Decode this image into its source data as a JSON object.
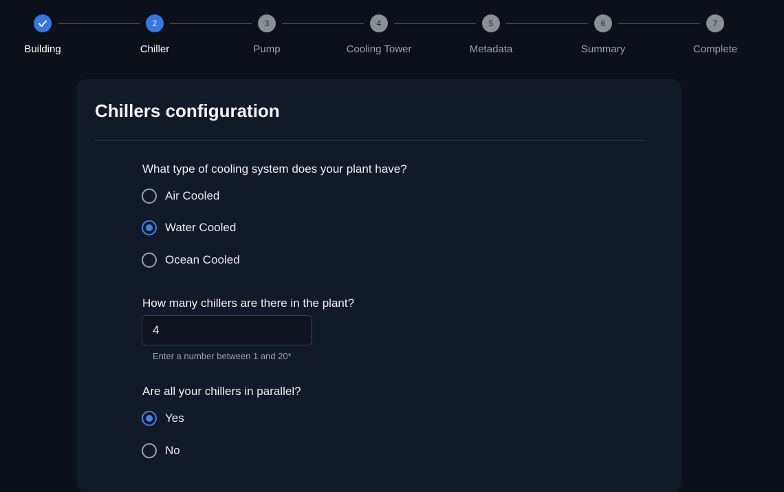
{
  "stepper": {
    "steps": [
      {
        "number": "1",
        "label": "Building",
        "status": "done"
      },
      {
        "number": "2",
        "label": "Chiller",
        "status": "active"
      },
      {
        "number": "3",
        "label": "Pump",
        "status": "pending"
      },
      {
        "number": "4",
        "label": "Cooling Tower",
        "status": "pending"
      },
      {
        "number": "5",
        "label": "Metadata",
        "status": "pending"
      },
      {
        "number": "6",
        "label": "Summary",
        "status": "pending"
      },
      {
        "number": "7",
        "label": "Complete",
        "status": "pending"
      }
    ]
  },
  "card": {
    "title": "Chillers configuration",
    "cooling": {
      "question": "What type of cooling system does your plant have?",
      "options": [
        "Air Cooled",
        "Water Cooled",
        "Ocean Cooled"
      ],
      "selected": "Water Cooled"
    },
    "count": {
      "question": "How many chillers are there in the plant?",
      "value": "4",
      "hint": "Enter a number between 1 and 20*"
    },
    "parallel": {
      "question": "Are all your chillers in parallel?",
      "options": [
        "Yes",
        "No"
      ],
      "selected": "Yes"
    }
  },
  "colors": {
    "accent": "#3c82f0",
    "background": "#0c1019",
    "card": "#131a27",
    "pending_step": "#8b8e94"
  },
  "icons": {
    "done_step": "checkmark-icon"
  }
}
